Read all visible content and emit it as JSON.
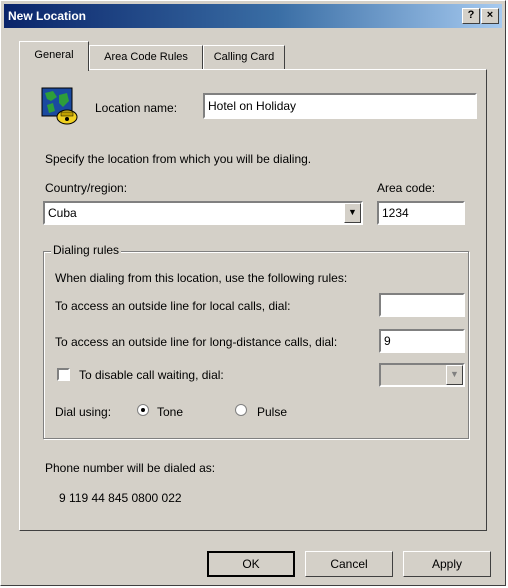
{
  "window": {
    "title": "New Location",
    "help_button": "?",
    "close_button": "×"
  },
  "tabs": [
    {
      "label": "General",
      "active": true
    },
    {
      "label": "Area Code Rules",
      "active": false
    },
    {
      "label": "Calling Card",
      "active": false
    }
  ],
  "general": {
    "location_name_label": "Location name:",
    "location_name_value": "Hotel on Holiday",
    "specify_text": "Specify the location from which you will be dialing.",
    "country_label": "Country/region:",
    "country_value": "Cuba",
    "area_code_label": "Area code:",
    "area_code_value": "1234"
  },
  "dialing_rules": {
    "legend": "Dialing rules",
    "intro": "When dialing from this location, use the following rules:",
    "local_label": "To access an outside line for local calls, dial:",
    "local_value": "",
    "long_distance_label": "To access an outside line for long-distance calls, dial:",
    "long_distance_value": "9",
    "call_waiting_label": "To disable call waiting, dial:",
    "call_waiting_checked": false,
    "call_waiting_value": "",
    "dial_using_label": "Dial using:",
    "tone_label": "Tone",
    "pulse_label": "Pulse",
    "selected": "Tone"
  },
  "phone": {
    "label": "Phone number will be dialed as:",
    "number": "9 119 44 845 0800 022"
  },
  "buttons": {
    "ok": "OK",
    "cancel": "Cancel",
    "apply": "Apply"
  },
  "icons": {
    "location": "globe-phone-icon"
  }
}
